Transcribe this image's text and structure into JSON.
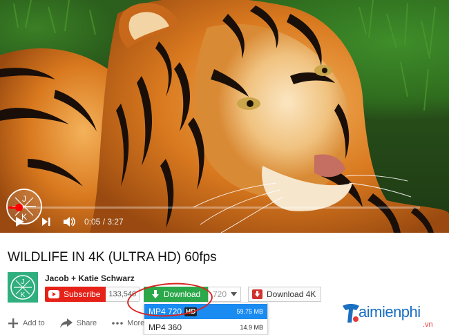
{
  "video": {
    "current_time": "0:05",
    "duration": "3:27",
    "progress": 0.026,
    "progress_color": "#ff0000",
    "watermark_letters": [
      "J",
      "K"
    ]
  },
  "title": "WILDLIFE IN 4K (ULTRA HD) 60fps",
  "channel": {
    "name": "Jacob + Katie Schwarz",
    "avatar_letters": [
      "J",
      "K"
    ],
    "avatar_color": "#2fae7e"
  },
  "subscribe": {
    "label": "Subscribe",
    "count": "133,546",
    "color": "#e62117"
  },
  "download": {
    "label": "Download",
    "color": "#2ba84a",
    "quality": "720",
    "download_4k_label": "Download 4K"
  },
  "dropdown": {
    "items": [
      {
        "format": "MP4 720",
        "badge": "HD",
        "size": "59.75 MB"
      },
      {
        "format": "MP4 360",
        "badge": "",
        "size": "14.9 MB"
      }
    ],
    "active_color": "#1a8bf1"
  },
  "actions": {
    "add_to": "Add to",
    "share": "Share",
    "more": "More"
  },
  "brand": {
    "text": "aimienphi",
    "suffix": ".vn"
  },
  "icons": {
    "play": "play-icon",
    "next": "next-icon",
    "volume": "volume-icon",
    "download_arrow": "download-arrow-icon",
    "dropdown": "chevron-down-icon",
    "youtube": "youtube-icon",
    "plus": "plus-icon",
    "share": "share-arrow-icon"
  }
}
